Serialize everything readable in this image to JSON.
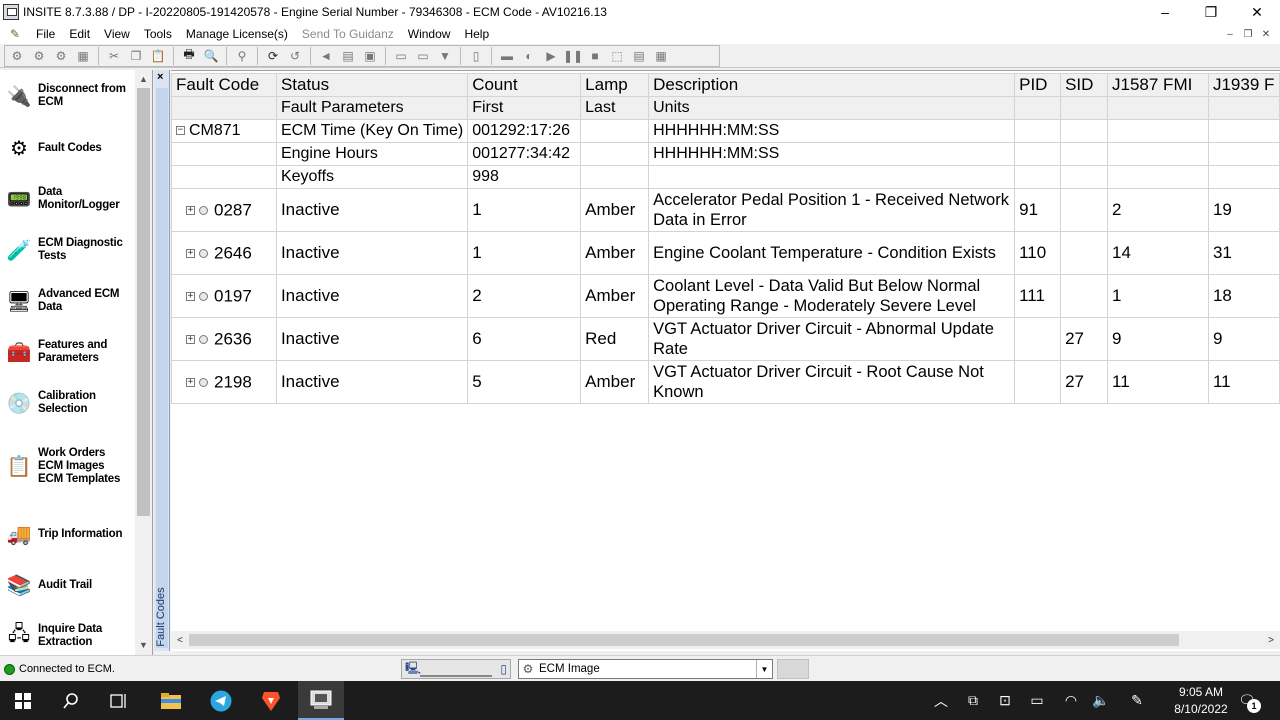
{
  "window": {
    "title": "INSITE 8.7.3.88  / DP - I-20220805-191420578 - Engine Serial Number - 79346308 - ECM Code - AV10216.13",
    "minimize": "–",
    "restore": "❐",
    "close": "✕"
  },
  "menu": {
    "items": [
      {
        "label": "File",
        "enabled": true
      },
      {
        "label": "Edit",
        "enabled": true
      },
      {
        "label": "View",
        "enabled": true
      },
      {
        "label": "Tools",
        "enabled": true
      },
      {
        "label": "Manage License(s)",
        "enabled": true
      },
      {
        "label": "Send To Guidanz",
        "enabled": false
      },
      {
        "label": "Window",
        "enabled": true
      },
      {
        "label": "Help",
        "enabled": true
      }
    ],
    "mdi_minimize": "–",
    "mdi_restore": "❐",
    "mdi_close": "✕"
  },
  "sidebar": {
    "items": [
      {
        "label": "Disconnect from ECM",
        "icon": "disconnect-icon",
        "glyph": "🔌"
      },
      {
        "label": "Fault Codes",
        "icon": "fault-codes-icon",
        "glyph": "⚙"
      },
      {
        "label": "Data Monitor/Logger",
        "icon": "data-monitor-icon",
        "glyph": "📟"
      },
      {
        "label": "ECM Diagnostic Tests",
        "icon": "diagnostic-tests-icon",
        "glyph": "🧪"
      },
      {
        "label": "Advanced ECM Data",
        "icon": "advanced-ecm-icon",
        "glyph": "🖥"
      },
      {
        "label": "Features and Parameters",
        "icon": "features-icon",
        "glyph": "🧰"
      },
      {
        "label": "Calibration Selection",
        "icon": "calibration-icon",
        "glyph": "💿"
      },
      {
        "label": "Work Orders ECM Images ECM Templates",
        "icon": "work-orders-icon",
        "glyph": "📋"
      },
      {
        "label": "Trip Information",
        "icon": "trip-info-icon",
        "glyph": "🚚"
      },
      {
        "label": "Audit Trail",
        "icon": "audit-trail-icon",
        "glyph": "📚"
      },
      {
        "label": "Inquire Data Extraction",
        "icon": "inquire-data-icon",
        "glyph": "🖧"
      }
    ]
  },
  "side_tab": {
    "label": "Fault Codes",
    "close": "×"
  },
  "grid": {
    "headers": [
      "Fault Code",
      "Status",
      "Count",
      "Lamp",
      "Description",
      "PID",
      "SID",
      "J1587 FMI",
      "J1939 F"
    ],
    "subheaders": [
      "",
      "Fault Parameters",
      "First",
      "Last",
      "Units",
      "",
      "",
      "",
      ""
    ],
    "expanded_group": {
      "code": "CM871",
      "expander": "−",
      "parameters": [
        {
          "name": "ECM Time (Key On Time)",
          "first": "001292:17:26",
          "last": "",
          "units": "HHHHHH:MM:SS"
        },
        {
          "name": "Engine Hours",
          "first": "001277:34:42",
          "last": "",
          "units": "HHHHHH:MM:SS"
        },
        {
          "name": "Keyoffs",
          "first": "998",
          "last": "",
          "units": ""
        }
      ]
    },
    "faults": [
      {
        "expander": "+",
        "code": "0287",
        "status": "Inactive",
        "count": "1",
        "lamp": "Amber",
        "description": "Accelerator Pedal Position 1 - Received Network Data in Error",
        "pid": "91",
        "sid": "",
        "j1587_fmi": "2",
        "j1939_fmi": "19"
      },
      {
        "expander": "+",
        "code": "2646",
        "status": "Inactive",
        "count": "1",
        "lamp": "Amber",
        "description": "Engine Coolant Temperature - Condition Exists",
        "pid": "110",
        "sid": "",
        "j1587_fmi": "14",
        "j1939_fmi": "31"
      },
      {
        "expander": "+",
        "code": "0197",
        "status": "Inactive",
        "count": "2",
        "lamp": "Amber",
        "description": "Coolant Level - Data Valid But Below Normal Operating Range - Moderately Severe Level",
        "pid": "111",
        "sid": "",
        "j1587_fmi": "1",
        "j1939_fmi": "18"
      },
      {
        "expander": "+",
        "code": "2636",
        "status": "Inactive",
        "count": "6",
        "lamp": "Red",
        "description": "VGT Actuator Driver Circuit - Abnormal Update Rate",
        "pid": "",
        "sid": "27",
        "j1587_fmi": "9",
        "j1939_fmi": "9"
      },
      {
        "expander": "+",
        "code": "2198",
        "status": "Inactive",
        "count": "5",
        "lamp": "Amber",
        "description": "VGT Actuator Driver Circuit - Root Cause Not Known",
        "pid": "",
        "sid": "27",
        "j1587_fmi": "11",
        "j1939_fmi": "11"
      }
    ]
  },
  "statusbar": {
    "connection_text": "Connected to ECM.",
    "selector_value": "ECM Image"
  },
  "taskbar": {
    "time": "9:05 AM",
    "date": "8/10/2022",
    "notification_count": "1"
  },
  "colors": {
    "status_led": "#1d9c1d",
    "taskbar": "#1c1c1c",
    "side_tab": "#dbe4f0"
  }
}
